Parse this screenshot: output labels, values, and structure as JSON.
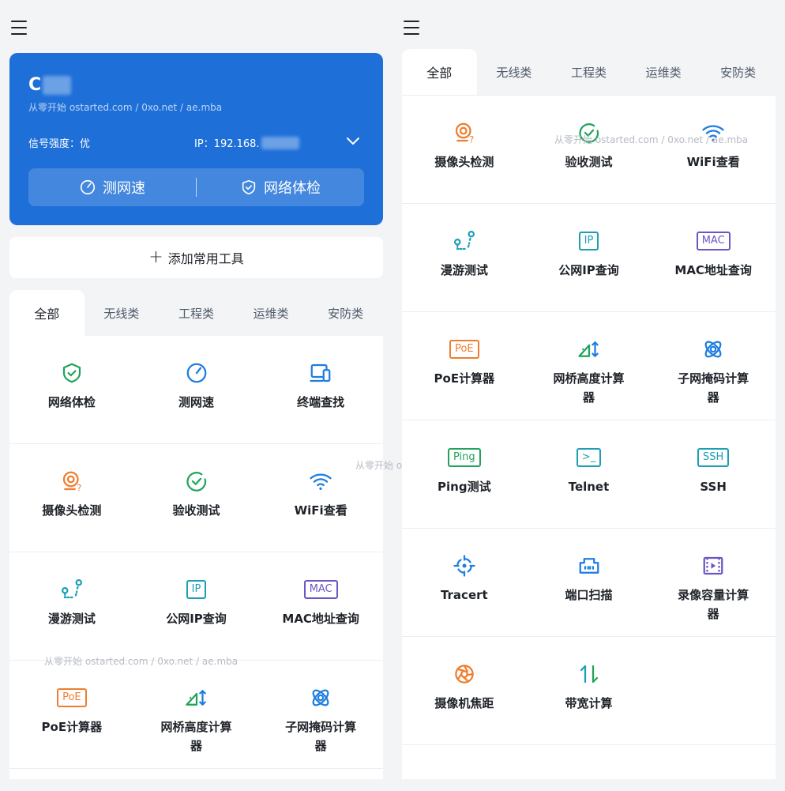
{
  "watermark": "从零开始 ostarted.com / 0xo.net / ae.mba",
  "card": {
    "ssid": "C",
    "signal_label": "信号强度：优",
    "ip_label": "IP：192.168.",
    "speed_btn": "测网速",
    "check_btn": "网络体检"
  },
  "add_tool": "添加常用工具",
  "tabs": [
    "全部",
    "无线类",
    "工程类",
    "运维类",
    "安防类"
  ],
  "tools": [
    {
      "label": "网络体检",
      "icon": "shield-check-icon",
      "color": "#21a35b"
    },
    {
      "label": "测网速",
      "icon": "speedometer-icon",
      "color": "#1e7de0"
    },
    {
      "label": "终端查找",
      "icon": "devices-icon",
      "color": "#1e7de0"
    },
    {
      "label": "摄像头检测",
      "icon": "camera-detect-icon",
      "color": "#ef7d2e"
    },
    {
      "label": "验收测试",
      "icon": "check-circle-icon",
      "color": "#21a35b"
    },
    {
      "label": "WiFi查看",
      "icon": "wifi-icon",
      "color": "#1e7de0"
    },
    {
      "label": "漫游测试",
      "icon": "roaming-icon",
      "color": "#1a9fb5"
    },
    {
      "label": "公网IP查询",
      "icon": "ip-icon",
      "color": "#1a9fb5",
      "box": "IP"
    },
    {
      "label": "MAC地址查询",
      "icon": "mac-icon",
      "color": "#6e55c4",
      "box": "MAC"
    },
    {
      "label": "PoE计算器",
      "icon": "poe-icon",
      "color": "#ef7d2e",
      "box": "PoE"
    },
    {
      "label": "网桥高度计算器",
      "icon": "bridge-height-icon",
      "color": "#21a35b"
    },
    {
      "label": "子网掩码计算器",
      "icon": "subnet-icon",
      "color": "#1e7de0"
    },
    {
      "label": "Ping测试",
      "icon": "ping-icon",
      "color": "#21a35b",
      "box": "Ping"
    },
    {
      "label": "Telnet",
      "icon": "terminal-icon",
      "color": "#1a9fb5",
      "box": ">_"
    },
    {
      "label": "SSH",
      "icon": "ssh-icon",
      "color": "#1a9fb5",
      "box": "SSH"
    },
    {
      "label": "Tracert",
      "icon": "crosshair-icon",
      "color": "#1e7de0"
    },
    {
      "label": "端口扫描",
      "icon": "port-icon",
      "color": "#1e7de0"
    },
    {
      "label": "录像容量计算器",
      "icon": "video-icon",
      "color": "#6e55c4"
    },
    {
      "label": "摄像机焦距",
      "icon": "aperture-icon",
      "color": "#ef7d2e"
    },
    {
      "label": "带宽计算",
      "icon": "bandwidth-icon",
      "color": "#1a9fb5"
    }
  ]
}
